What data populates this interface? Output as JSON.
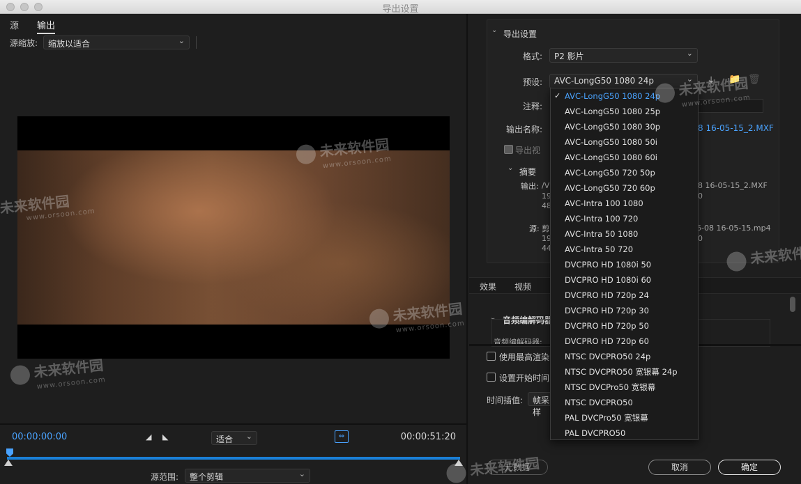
{
  "window": {
    "title": "导出设置"
  },
  "left": {
    "tabs": [
      {
        "label": "源"
      },
      {
        "label": "输出"
      }
    ],
    "scale_label": "源缩放:",
    "scale_value": "缩放以适合",
    "timecode_start": "00:00:00:00",
    "timecode_end": "00:00:51:20",
    "zoom_value": "适合",
    "range_label": "源范围:",
    "range_value": "整个剪辑"
  },
  "right": {
    "section_title": "导出设置",
    "format_label": "格式:",
    "format_value": "P2 影片",
    "preset_label": "预设:",
    "preset_value": "AVC-LongG50 1080 24p",
    "comment_label": "注释:",
    "output_name_label": "输出名称:",
    "output_name_value": "8 16-05-15_2.MXF",
    "export_video_label": "导出视",
    "summary_label": "摘要",
    "summary_output_label": "输出:",
    "summary_output_line1": "/V",
    "summary_output_line1_right": "8 16-05-15_2.MXF",
    "summary_output_line2": "19",
    "summary_output_line2_right": "0",
    "summary_output_line3": "48",
    "summary_source_label": "源: 剪",
    "summary_source_right": "6-08 16-05-15.mp4",
    "summary_source_line2": "19",
    "summary_source_line2_right": "0",
    "summary_source_line3": "44",
    "tabs": [
      {
        "label": "效果"
      },
      {
        "label": "视频"
      }
    ],
    "audio_codec_section": "音频编解码器",
    "audio_codec_label": "音频编解码器:",
    "max_render_label": "使用最高渲染",
    "set_start_label": "设置开始时间",
    "interp_label": "时间插值:",
    "interp_value": "帧采样",
    "metadata_button": "元数据",
    "cancel_button": "取消",
    "ok_button": "确定"
  },
  "preset_menu": {
    "items": [
      "AVC-LongG50 1080 24p",
      "AVC-LongG50 1080 25p",
      "AVC-LongG50 1080 30p",
      "AVC-LongG50 1080 50i",
      "AVC-LongG50 1080 60i",
      "AVC-LongG50 720 50p",
      "AVC-LongG50 720 60p",
      "AVC-Intra 100 1080",
      "AVC-Intra 100 720",
      "AVC-Intra 50 1080",
      "AVC-Intra 50 720",
      "DVCPRO HD 1080i 50",
      "DVCPRO HD 1080i 60",
      "DVCPRO HD 720p 24",
      "DVCPRO HD 720p 30",
      "DVCPRO HD 720p 50",
      "DVCPRO HD 720p 60",
      "NTSC DVCPRO50 24p",
      "NTSC DVCPRO50 宽银幕 24p",
      "NTSC DVCPro50 宽银幕",
      "NTSC DVCPRO50",
      "PAL DVCPro50 宽银幕",
      "PAL DVCPRO50"
    ],
    "selected_index": 0
  },
  "watermark": {
    "text": "未来软件园",
    "url": "www.orsoon.com"
  },
  "colors": {
    "accent": "#4aa3ff",
    "background": "#1e1e1e"
  }
}
